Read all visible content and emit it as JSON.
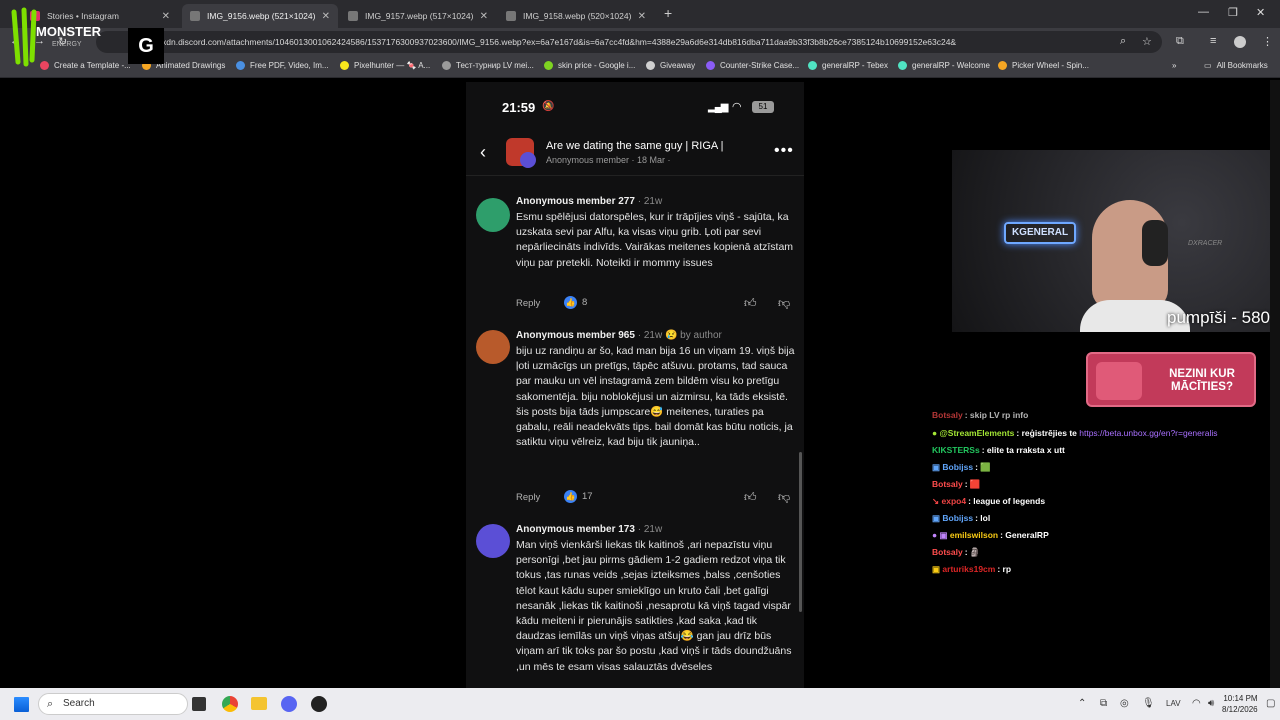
{
  "browser": {
    "tabs": [
      {
        "label": "Stories • Instagram",
        "active": false
      },
      {
        "label": "IMG_9156.webp (521×1024)",
        "active": true
      },
      {
        "label": "IMG_9157.webp (517×1024)",
        "active": false
      },
      {
        "label": "IMG_9158.webp (520×1024)",
        "active": false
      }
    ],
    "url": "xdn.discord.com/attachments/1046013001062424586/1537176300937023600/IMG_9156.webp?ex=6a7e167d&is=6a7cc4fd&hm=4388e29a6d6e314db816dba711daa9b33f3b8b26ce7385124b10699152e63c24&",
    "bookmarks": [
      {
        "label": "Create a Template -...",
        "color": "#e94560"
      },
      {
        "label": "Animated Drawings",
        "color": "#f5a623"
      },
      {
        "label": "Free PDF, Video, Im...",
        "color": "#4a90e2"
      },
      {
        "label": "Pixelhunter — 🍬 A...",
        "color": "#f8e71c"
      },
      {
        "label": "Тест-турнир LV mei...",
        "color": "#9b9b9b"
      },
      {
        "label": "skin price - Google i...",
        "color": "#7ed321"
      },
      {
        "label": "Giveaway",
        "color": "#d0d0d0"
      },
      {
        "label": "Counter-Strike Case...",
        "color": "#8b5cf6"
      },
      {
        "label": "generalRP - Tebex",
        "color": "#50e3c2"
      },
      {
        "label": "generalRP - Welcome",
        "color": "#50e3c2"
      },
      {
        "label": "Picker Wheel - Spin...",
        "color": "#f5a623"
      }
    ],
    "all_bookmarks": "All Bookmarks"
  },
  "overlay": {
    "logo_text": "MONSTER",
    "logo_sub": "ENERGY",
    "g_box": "G"
  },
  "phone": {
    "time": "21:59",
    "battery": "51",
    "title": "Are we dating the same guy | RIGA |",
    "subtitle": "Anonymous member · 18 Mar ·",
    "comments": [
      {
        "author": "Anonymous member 277",
        "ago": "· 21w",
        "badge": "",
        "text": "Esmu spēlējusi datorspēles, kur ir trāpījies viņš - sajūta, ka uzskata sevi par Alfu, ka visas viņu grib. Ļoti par sevi nepārliecināts indivīds. Vairākas meitenes kopienā atzīstam viņu par pretekli. Noteikti ir mommy issues",
        "reply": "Reply",
        "likes": "8",
        "avatar_color": "#2e9e6b"
      },
      {
        "author": "Anonymous member 965",
        "ago": "· 21w",
        "badge": "😢 by author",
        "text": "biju uz randiņu ar šo, kad man bija 16 un viņam 19. viņš bija ļoti uzmācīgs un pretīgs, tāpēc atšuvu. protams, tad sauca par mauku un vēl instagramā zem bildēm visu ko pretīgu sakomentēja. biju noblokējusi un aizmirsu, ka tāds eksistē. šis posts bija tāds jumpscare😅 meitenes, turaties pa gabalu, reāli neadekvāts tips. bail domāt kas būtu noticis, ja satiktu viņu vēlreiz, kad biju tik jauniņa..",
        "reply": "Reply",
        "likes": "17",
        "avatar_color": "#b85a2b"
      },
      {
        "author": "Anonymous member 173",
        "ago": "· 21w",
        "badge": "",
        "text": "Man viņš vienkārši liekas tik kaitinoš ,ari nepazīstu viņu personīgi ,bet jau pirms gādiem 1-2 gadiem redzot viņa tik tokus ,tas runas veids ,sejas izteiksmes ,balss ,cenšoties tēlot kaut kādu super smieklīgo un kruto čali ,bet galīgi nesanāk ,liekas tik kaitinoši ,nesaprotu kā viņš tagad vispār kādu meiteni ir pierunājis satikties ,kad saka ,kad tik daudzas iemīlās un viņš viņas atšuj😂 gan jau drīz būs viņam arī tik toks par šo postu ,kad viņš ir tāds doundžuāns ,un mēs te esam visas salauztās dvēseles",
        "reply": "",
        "likes": "",
        "avatar_color": "#5b4fd6"
      }
    ]
  },
  "webcam": {
    "caption": "pumpīši - 580",
    "sign": "KGENERAL",
    "brand": "DXRACER"
  },
  "ad": {
    "text": "NEZINI KUR MĀCĪTIES?"
  },
  "chat": [
    {
      "user": "Botsaly",
      "color": "#ff4d4d",
      "text": ": skip LV rp info"
    },
    {
      "user": "@StreamElements",
      "color": "#a3e635",
      "text": ": reģistrējies te ",
      "link": "https://beta.unbox.gg/en?r=generalis"
    },
    {
      "user": "KIKSTERSs",
      "color": "#22c55e",
      "text": ": elite ta rraksta x utt"
    },
    {
      "user": "Bobijss",
      "color": "#60a5fa",
      "text": ": 🟩"
    },
    {
      "user": "Botsaly",
      "color": "#ff4d4d",
      "text": ": 🟥"
    },
    {
      "user": "expo4",
      "color": "#ef4444",
      "text": ": league of legends"
    },
    {
      "user": "Bobijss",
      "color": "#60a5fa",
      "text": ": lol"
    },
    {
      "user": "emilswilson",
      "color": "#facc15",
      "text": ": GeneralRP"
    },
    {
      "user": "Botsaly",
      "color": "#ff4d4d",
      "text": ": 🗿"
    },
    {
      "user": "arturiks19cm",
      "color": "#dc2626",
      "text": ": rp"
    }
  ],
  "taskbar": {
    "search": "Search",
    "lang": "LAV",
    "time": "10:14 PM",
    "date": "8/12/2026"
  }
}
